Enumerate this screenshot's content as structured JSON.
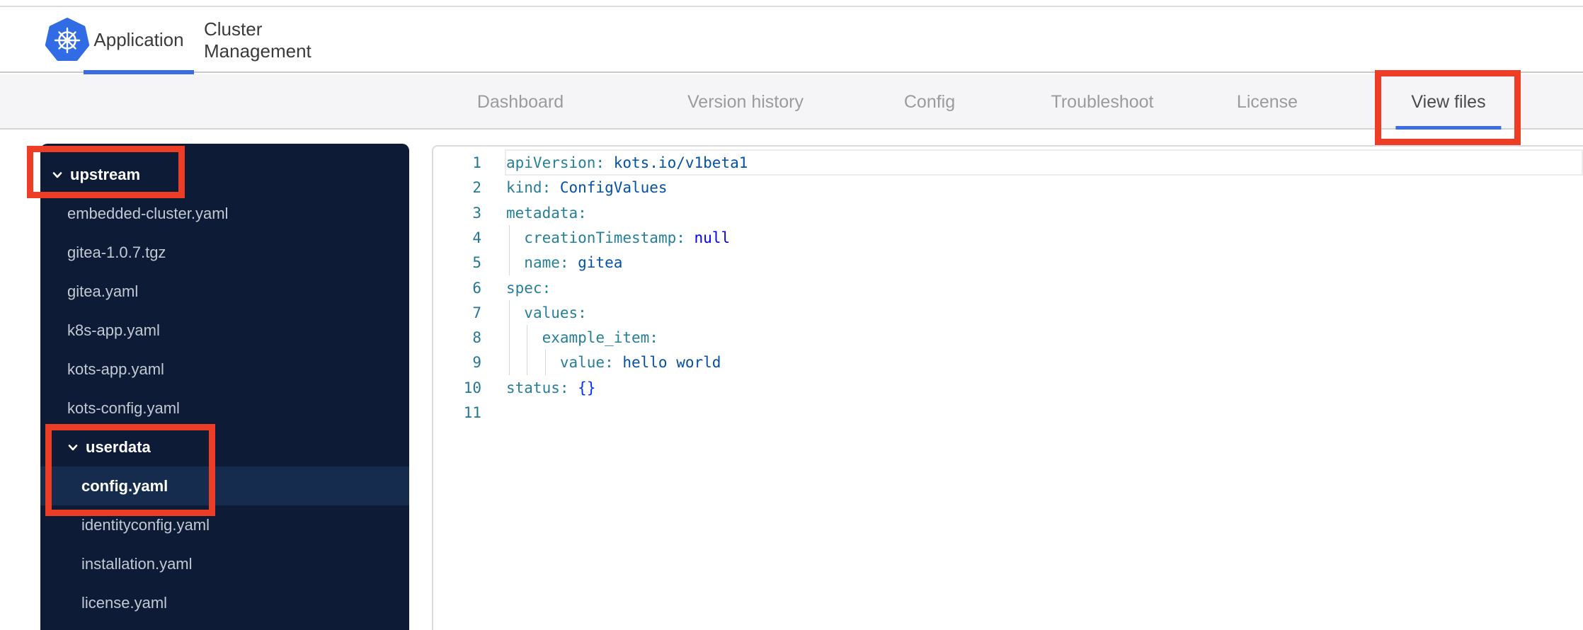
{
  "header": {
    "tabs": [
      {
        "label": "Application",
        "active": true
      },
      {
        "label": "Cluster Management",
        "active": false
      }
    ]
  },
  "subnav": {
    "items": [
      {
        "label": "Dashboard",
        "active": false
      },
      {
        "label": "Version history",
        "active": false
      },
      {
        "label": "Config",
        "active": false
      },
      {
        "label": "Troubleshoot",
        "active": false
      },
      {
        "label": "License",
        "active": false
      },
      {
        "label": "View files",
        "active": true
      }
    ]
  },
  "file_tree": {
    "items": [
      {
        "label": "upstream",
        "type": "folder",
        "depth": 0,
        "expanded": true,
        "annotated": true
      },
      {
        "label": "embedded-cluster.yaml",
        "type": "file",
        "depth": 1
      },
      {
        "label": "gitea-1.0.7.tgz",
        "type": "file",
        "depth": 1
      },
      {
        "label": "gitea.yaml",
        "type": "file",
        "depth": 1
      },
      {
        "label": "k8s-app.yaml",
        "type": "file",
        "depth": 1
      },
      {
        "label": "kots-app.yaml",
        "type": "file",
        "depth": 1
      },
      {
        "label": "kots-config.yaml",
        "type": "file",
        "depth": 1
      },
      {
        "label": "userdata",
        "type": "folder",
        "depth": 1,
        "expanded": true,
        "annotated": true
      },
      {
        "label": "config.yaml",
        "type": "file",
        "depth": 2,
        "selected": true,
        "annotated": true
      },
      {
        "label": "identityconfig.yaml",
        "type": "file",
        "depth": 2
      },
      {
        "label": "installation.yaml",
        "type": "file",
        "depth": 2
      },
      {
        "label": "license.yaml",
        "type": "file",
        "depth": 2
      }
    ]
  },
  "editor": {
    "language": "yaml",
    "lines": [
      {
        "n": "1",
        "segs": [
          {
            "t": "apiVersion:",
            "c": "key"
          },
          {
            "t": " kots.io/v1beta1",
            "c": "val"
          }
        ]
      },
      {
        "n": "2",
        "segs": [
          {
            "t": "kind:",
            "c": "key"
          },
          {
            "t": " ConfigValues",
            "c": "val"
          }
        ]
      },
      {
        "n": "3",
        "segs": [
          {
            "t": "metadata:",
            "c": "key"
          }
        ]
      },
      {
        "n": "4",
        "segs": [
          {
            "t": "  ",
            "c": "plain"
          },
          {
            "t": "creationTimestamp:",
            "c": "key"
          },
          {
            "t": " ",
            "c": "plain"
          },
          {
            "t": "null",
            "c": "kw"
          }
        ]
      },
      {
        "n": "5",
        "segs": [
          {
            "t": "  ",
            "c": "plain"
          },
          {
            "t": "name:",
            "c": "key"
          },
          {
            "t": " gitea",
            "c": "val"
          }
        ]
      },
      {
        "n": "6",
        "segs": [
          {
            "t": "spec:",
            "c": "key"
          }
        ]
      },
      {
        "n": "7",
        "segs": [
          {
            "t": "  ",
            "c": "plain"
          },
          {
            "t": "values:",
            "c": "key"
          }
        ]
      },
      {
        "n": "8",
        "segs": [
          {
            "t": "    ",
            "c": "plain"
          },
          {
            "t": "example_item:",
            "c": "key"
          }
        ]
      },
      {
        "n": "9",
        "segs": [
          {
            "t": "      ",
            "c": "plain"
          },
          {
            "t": "value:",
            "c": "key"
          },
          {
            "t": " hello world",
            "c": "val"
          }
        ]
      },
      {
        "n": "10",
        "segs": [
          {
            "t": "status:",
            "c": "key"
          },
          {
            "t": " ",
            "c": "plain"
          },
          {
            "t": "{}",
            "c": "br"
          }
        ]
      },
      {
        "n": "11",
        "segs": []
      }
    ],
    "current_line": 1
  },
  "annotations": {
    "color": "#ee3d25",
    "targets": [
      "subnav-view-files",
      "tree-folder-upstream",
      "tree-folder-userdata-and-config.yaml"
    ]
  },
  "colors": {
    "brand_blue": "#326ce5",
    "accent_blue": "#3b6ce4",
    "annotation_red": "#ee3d25",
    "sidebar_bg": "#0d1b37",
    "sidebar_selected": "#152c4e",
    "token_key": "#267f99",
    "token_value": "#0451a5",
    "token_keyword": "#0000ff",
    "token_bracket": "#0431fa",
    "line_number": "#237893"
  }
}
